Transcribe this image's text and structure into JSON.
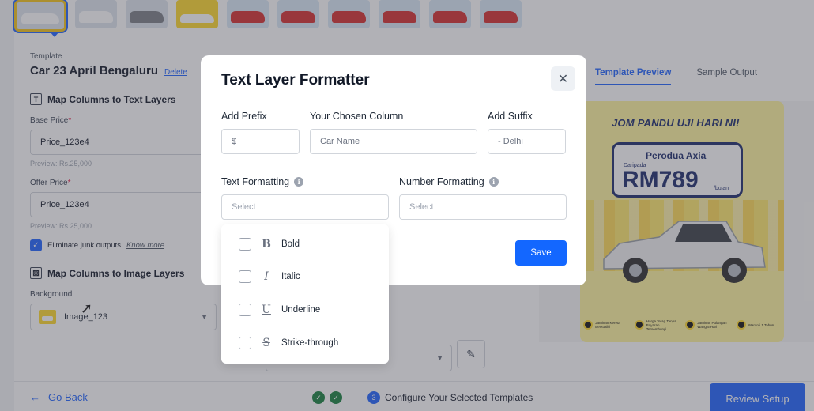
{
  "page": {
    "template_label": "Template",
    "template_name": "Car 23 April Bengaluru",
    "delete_link": "Delete",
    "text_layers_title": "Map Columns to Text Layers",
    "base_price_label": "Base Price",
    "base_price_value": "Price_123e4",
    "base_price_preview": "Preview: Rs.25,000",
    "offer_price_label": "Offer Price",
    "offer_price_value": "Price_123e4",
    "offer_price_preview": "Preview: Rs.25,000",
    "junk_checkbox_label": "Eliminate junk outputs",
    "know_more": "Know more",
    "image_layers_title": "Map Columns to Image Layers",
    "background_label": "Background",
    "background_value": "Image_123"
  },
  "tabs": [
    "Template Preview",
    "Sample Output"
  ],
  "banner": {
    "headline": "JOM PANDU UJI HARI NI!",
    "model": "Perodua Axia",
    "from_label": "Daripada",
    "price": "RM789",
    "unit": "/bulan",
    "badges": [
      "Jaminan Kereta Berkualiti",
      "Harga Tetap Tanpa Bayaran Tersembunyi",
      "Jaminan Pulangan Wang 5 Hari",
      "Waranti 1 Tahun"
    ]
  },
  "footer": {
    "go_back": "Go Back",
    "step_current_number": "3",
    "step_current_label": "Configure Your Selected Templates",
    "review_button": "Review Setup"
  },
  "modal": {
    "title": "Text Layer Formatter",
    "prefix_label": "Add Prefix",
    "prefix_value": "$",
    "column_label": "Your Chosen Column",
    "column_value": "Car Name",
    "suffix_label": "Add Suffix",
    "suffix_value": "- Delhi",
    "text_formatting_label": "Text Formatting",
    "text_formatting_placeholder": "Select",
    "number_formatting_label": "Number Formatting",
    "number_formatting_placeholder": "Select",
    "save_button": "Save",
    "options": [
      {
        "label": "Bold",
        "glyph": "B"
      },
      {
        "label": "Italic",
        "glyph": "I"
      },
      {
        "label": "Underline",
        "glyph": "U"
      },
      {
        "label": "Strike-through",
        "glyph": "S"
      }
    ]
  },
  "colors": {
    "primary": "#1e63ff",
    "success": "#15803d",
    "brand_yellow": "#ffd92a",
    "banner_navy": "#1a2a6c"
  }
}
